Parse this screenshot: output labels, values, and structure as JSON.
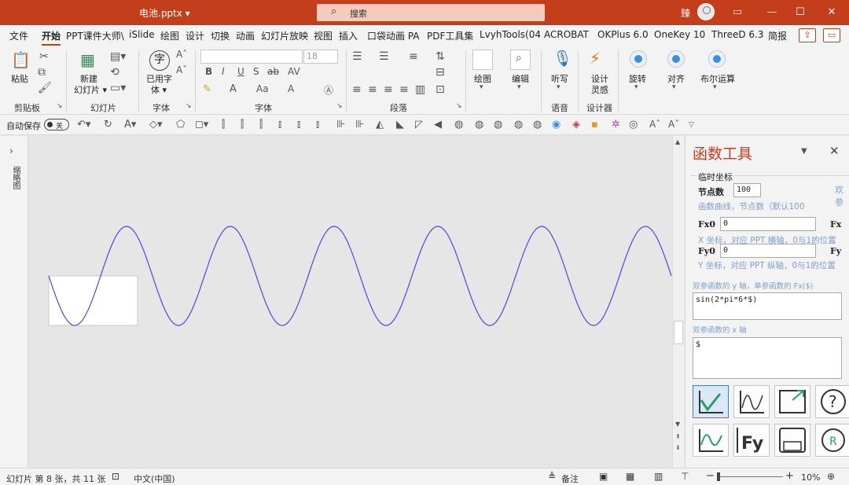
{
  "titlebar": {
    "doc_title": "电池.pptx ▾",
    "search_placeholder": "搜索",
    "user_name": "臻",
    "ribbon_display_icon": "ribbon-display-icon",
    "minimize": "—",
    "maximize": "☐",
    "close": "✕"
  },
  "tabs": [
    "文件",
    "开始",
    "PPT课件大师\\",
    "iSlide",
    "绘图",
    "设计",
    "切换",
    "动画",
    "幻灯片放映",
    "视图",
    "插入",
    "口袋动画 PA",
    "PDF工具集",
    "LvyhTools(04",
    "ACROBAT",
    "OKPlus 6.0",
    "OneKey 10",
    "ThreeD 6.3",
    "简报"
  ],
  "active_tab": "开始",
  "ribbon": {
    "clipboard": {
      "paste": "粘贴",
      "group": "剪贴板"
    },
    "slides": {
      "new_slide": "新建",
      "new_slide2": "幻灯片 ▾",
      "group": "幻灯片"
    },
    "font_big": {
      "used_font": "已用字",
      "used_font2": "体 ▾",
      "group": "字体",
      "glyph": "字"
    },
    "font": {
      "size": "18",
      "group": "字体"
    },
    "paragraph": {
      "group": "段落"
    },
    "drawing": {
      "label": "绘图"
    },
    "editing": {
      "label": "编辑"
    },
    "voice": {
      "dictate": "听写",
      "group": "语音"
    },
    "designer": {
      "label1": "设计",
      "label2": "灵感",
      "group": "设计器"
    },
    "rotate": {
      "label": "旋转"
    },
    "align": {
      "label": "对齐"
    },
    "boolean": {
      "label": "布尔运算"
    }
  },
  "qat": {
    "autosave_label": "自动保存",
    "autosave_state": "关"
  },
  "leftpane": {
    "label": "缩略图"
  },
  "chart_data": {
    "type": "line",
    "function": "sin(2*pi*6*$)",
    "cycles": 6,
    "nodes": 100,
    "color": "#4a4ae0"
  },
  "function_pane": {
    "title": "函数工具",
    "group_label": "临时坐标",
    "nodes_label": "节点数",
    "nodes_value": "100",
    "nodes_hint": "函数曲线，节点数（默认100",
    "side_text1": "欢",
    "side_text2": "参",
    "fx0_label": "Fx0",
    "fx0_value": "0",
    "fx0_right": "Fx",
    "fx0_hint": "X 坐标，对应 PPT 横轴，0与1的位置",
    "fy0_label": "Fy0",
    "fy0_value": "0",
    "fy0_right": "Fy",
    "fy0_hint": "Y 坐标，对应 PPT 纵轴，0与1的位置",
    "y_axis_hint": "双参函数的 y 轴，单参函数的 Fx($)",
    "y_expr": "sin(2*pi*6*$)",
    "x_axis_hint": "双参函数的 x 轴",
    "x_expr": "$",
    "fy_button": "Fy"
  },
  "statusbar": {
    "slide_info": "幻灯片 第 8 张，共 11 张",
    "language": "中文(中国)",
    "notes": "备注",
    "zoom": "10%"
  },
  "colors": {
    "accent": "#c43e1c",
    "curve": "#4a4ae0"
  }
}
